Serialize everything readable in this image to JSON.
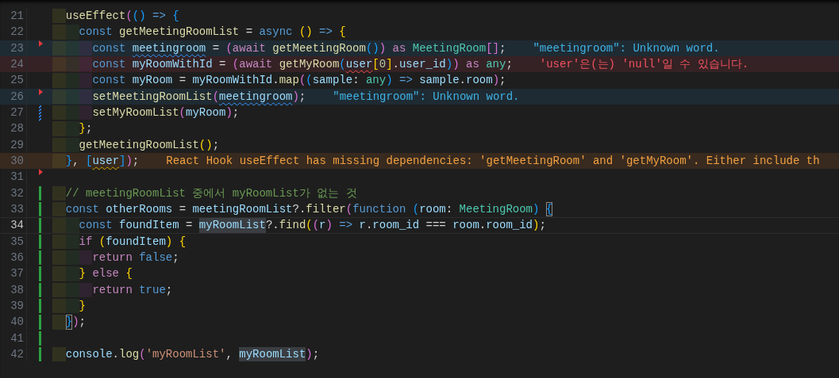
{
  "editor": {
    "lines": [
      {
        "number": "21",
        "current": false,
        "tokens": [
          {
            "kind": "fn",
            "text": "  useEffect"
          },
          {
            "kind": "b2",
            "text": "("
          },
          {
            "kind": "b3",
            "text": "()"
          },
          {
            "kind": "kw",
            "text": " => "
          },
          {
            "kind": "b3",
            "text": "{"
          }
        ]
      },
      {
        "number": "22",
        "current": false,
        "tokens": [
          {
            "kind": "kw",
            "text": "    const "
          },
          {
            "kind": "fn",
            "text": "getMeetingRoomList"
          },
          {
            "kind": "punc",
            "text": " = "
          },
          {
            "kind": "kw",
            "text": "async "
          },
          {
            "kind": "b1",
            "text": "()"
          },
          {
            "kind": "kw",
            "text": " => "
          },
          {
            "kind": "b1",
            "text": "{"
          }
        ]
      },
      {
        "number": "23",
        "current": false,
        "deleted": true,
        "tokens": [
          {
            "kind": "kw",
            "text": "      const "
          },
          {
            "kind": "var",
            "text": "meetingroom",
            "squiggled": true
          },
          {
            "kind": "punc",
            "text": " = "
          },
          {
            "kind": "b2",
            "text": "("
          },
          {
            "kind": "ctrl",
            "text": "await "
          },
          {
            "kind": "fn",
            "text": "getMeetingRoom"
          },
          {
            "kind": "b3",
            "text": "()"
          },
          {
            "kind": "b2",
            "text": ")"
          },
          {
            "kind": "ctrl",
            "text": " as "
          },
          {
            "kind": "type",
            "text": "MeetingRoom"
          },
          {
            "kind": "b2",
            "text": "[]"
          },
          {
            "kind": "punc",
            "text": ";"
          }
        ],
        "diagnostic": {
          "kind": "info",
          "text": "\"meetingroom\": Unknown word."
        }
      },
      {
        "number": "24",
        "current": false,
        "tokens": [
          {
            "kind": "kw",
            "text": "      const "
          },
          {
            "kind": "var",
            "text": "myRoomWithId"
          },
          {
            "kind": "punc",
            "text": " = "
          },
          {
            "kind": "b2",
            "text": "("
          },
          {
            "kind": "ctrl",
            "text": "await "
          },
          {
            "kind": "fn",
            "text": "getMyRoom"
          },
          {
            "kind": "b3",
            "text": "("
          },
          {
            "kind": "var",
            "text": "user",
            "squiggled": true
          },
          {
            "kind": "b1",
            "text": "["
          },
          {
            "kind": "num",
            "text": "0"
          },
          {
            "kind": "b1",
            "text": "]"
          },
          {
            "kind": "punc",
            "text": "."
          },
          {
            "kind": "var",
            "text": "user_id"
          },
          {
            "kind": "b3",
            "text": ")"
          },
          {
            "kind": "b2",
            "text": ")"
          },
          {
            "kind": "ctrl",
            "text": " as "
          },
          {
            "kind": "type",
            "text": "any"
          },
          {
            "kind": "punc",
            "text": ";"
          }
        ],
        "diagnostic": {
          "kind": "error",
          "text": "'user'은(는) 'null'일 수 있습니다."
        }
      },
      {
        "number": "25",
        "current": false,
        "tokens": [
          {
            "kind": "kw",
            "text": "      const "
          },
          {
            "kind": "var",
            "text": "myRoom"
          },
          {
            "kind": "punc",
            "text": " = "
          },
          {
            "kind": "var",
            "text": "myRoomWithId"
          },
          {
            "kind": "punc",
            "text": "."
          },
          {
            "kind": "fn",
            "text": "map"
          },
          {
            "kind": "b2",
            "text": "("
          },
          {
            "kind": "b3",
            "text": "("
          },
          {
            "kind": "var",
            "text": "sample"
          },
          {
            "kind": "punc",
            "text": ": "
          },
          {
            "kind": "type",
            "text": "any"
          },
          {
            "kind": "b3",
            "text": ")"
          },
          {
            "kind": "kw",
            "text": " => "
          },
          {
            "kind": "var",
            "text": "sample"
          },
          {
            "kind": "punc",
            "text": "."
          },
          {
            "kind": "var",
            "text": "room"
          },
          {
            "kind": "b2",
            "text": ")"
          },
          {
            "kind": "punc",
            "text": ";"
          }
        ]
      },
      {
        "number": "26",
        "current": false,
        "deleted": true,
        "tokens": [
          {
            "kind": "fn",
            "text": "      setMeetingRoomList"
          },
          {
            "kind": "b2",
            "text": "("
          },
          {
            "kind": "var",
            "text": "meetingroom",
            "squiggled": true
          },
          {
            "kind": "b2",
            "text": ")"
          },
          {
            "kind": "punc",
            "text": ";"
          }
        ],
        "diagnostic": {
          "kind": "info",
          "text": "\"meetingroom\": Unknown word."
        }
      },
      {
        "number": "27",
        "current": false,
        "modified": true,
        "tokens": [
          {
            "kind": "fn",
            "text": "      setMyRoomList"
          },
          {
            "kind": "b2",
            "text": "("
          },
          {
            "kind": "var",
            "text": "myRoom"
          },
          {
            "kind": "b2",
            "text": ")"
          },
          {
            "kind": "punc",
            "text": ";"
          }
        ]
      },
      {
        "number": "28",
        "current": false,
        "tokens": [
          {
            "kind": "b1",
            "text": "    }"
          },
          {
            "kind": "punc",
            "text": ";"
          }
        ]
      },
      {
        "number": "29",
        "current": false,
        "tokens": [
          {
            "kind": "fn",
            "text": "    getMeetingRoomList"
          },
          {
            "kind": "b1",
            "text": "()"
          },
          {
            "kind": "punc",
            "text": ";"
          }
        ]
      },
      {
        "number": "30",
        "current": false,
        "tokens": [
          {
            "kind": "b3",
            "text": "  }"
          },
          {
            "kind": "punc",
            "text": ", "
          },
          {
            "kind": "b3",
            "text": "["
          },
          {
            "kind": "var",
            "text": "user",
            "squiggled": true
          },
          {
            "kind": "b3",
            "text": "]"
          },
          {
            "kind": "b2",
            "text": ")"
          },
          {
            "kind": "punc",
            "text": ";"
          }
        ],
        "diagnostic": {
          "kind": "warning",
          "text": "React Hook useEffect has missing dependencies: 'getMeetingRoom' and 'getMyRoom'. Either include th"
        }
      },
      {
        "number": "31",
        "current": false,
        "deleted": true
      },
      {
        "number": "32",
        "current": false,
        "added": true,
        "tokens": [
          {
            "kind": "comment",
            "text": "  // meetingRoomList 중에서 myRoomList가 없는 것"
          }
        ]
      },
      {
        "number": "33",
        "current": false,
        "added": true,
        "tokens": [
          {
            "kind": "kw",
            "text": "  const "
          },
          {
            "kind": "var",
            "text": "otherRooms"
          },
          {
            "kind": "punc",
            "text": " = "
          },
          {
            "kind": "var",
            "text": "meetingRoomList"
          },
          {
            "kind": "punc",
            "text": "?."
          },
          {
            "kind": "fn",
            "text": "filter"
          },
          {
            "kind": "b2",
            "text": "("
          },
          {
            "kind": "kw",
            "text": "function "
          },
          {
            "kind": "b3",
            "text": "("
          },
          {
            "kind": "var",
            "text": "room"
          },
          {
            "kind": "punc",
            "text": ": "
          },
          {
            "kind": "type",
            "text": "MeetingRoom"
          },
          {
            "kind": "b3",
            "text": ") "
          },
          {
            "kind": "b3",
            "text": "{",
            "matched": true
          }
        ]
      },
      {
        "number": "34",
        "current": true,
        "added": true,
        "tokens": [
          {
            "kind": "kw",
            "text": "    const "
          },
          {
            "kind": "var",
            "text": "foundItem"
          },
          {
            "kind": "punc",
            "text": " = "
          },
          {
            "kind": "var",
            "text": "myRoomList",
            "highlighted": true
          },
          {
            "kind": "punc",
            "text": "?."
          },
          {
            "kind": "fn",
            "text": "find"
          },
          {
            "kind": "b1",
            "text": "("
          },
          {
            "kind": "b2",
            "text": "("
          },
          {
            "kind": "var",
            "text": "r"
          },
          {
            "kind": "b2",
            "text": ")"
          },
          {
            "kind": "kw",
            "text": " => "
          },
          {
            "kind": "var",
            "text": "r"
          },
          {
            "kind": "punc",
            "text": "."
          },
          {
            "kind": "var",
            "text": "room_id"
          },
          {
            "kind": "punc",
            "text": " === "
          },
          {
            "kind": "var",
            "text": "room"
          },
          {
            "kind": "punc",
            "text": "."
          },
          {
            "kind": "var",
            "text": "room_id"
          },
          {
            "kind": "b1",
            "text": ")"
          },
          {
            "kind": "punc",
            "text": ";"
          }
        ]
      },
      {
        "number": "35",
        "current": false,
        "added": true,
        "tokens": [
          {
            "kind": "ctrl",
            "text": "    if "
          },
          {
            "kind": "b1",
            "text": "("
          },
          {
            "kind": "var",
            "text": "foundItem"
          },
          {
            "kind": "b1",
            "text": ") "
          },
          {
            "kind": "b1",
            "text": "{"
          }
        ]
      },
      {
        "number": "36",
        "current": false,
        "added": true,
        "tokens": [
          {
            "kind": "ctrl",
            "text": "      return "
          },
          {
            "kind": "kw",
            "text": "false"
          },
          {
            "kind": "punc",
            "text": ";"
          }
        ]
      },
      {
        "number": "37",
        "current": false,
        "added": true,
        "tokens": [
          {
            "kind": "b1",
            "text": "    }"
          },
          {
            "kind": "ctrl",
            "text": " else "
          },
          {
            "kind": "b1",
            "text": "{"
          }
        ]
      },
      {
        "number": "38",
        "current": false,
        "added": true,
        "tokens": [
          {
            "kind": "ctrl",
            "text": "      return "
          },
          {
            "kind": "kw",
            "text": "true"
          },
          {
            "kind": "punc",
            "text": ";"
          }
        ]
      },
      {
        "number": "39",
        "current": false,
        "added": true,
        "tokens": [
          {
            "kind": "b1",
            "text": "    }"
          }
        ]
      },
      {
        "number": "40",
        "current": false,
        "added": true,
        "tokens": [
          {
            "kind": "b3",
            "text": "  }",
            "matched": true
          },
          {
            "kind": "b2",
            "text": ")"
          },
          {
            "kind": "punc",
            "text": ";"
          }
        ]
      },
      {
        "number": "41",
        "current": false,
        "added": true
      },
      {
        "number": "42",
        "current": false,
        "added": true,
        "tokens": [
          {
            "kind": "var",
            "text": "  console"
          },
          {
            "kind": "punc",
            "text": "."
          },
          {
            "kind": "fn",
            "text": "log"
          },
          {
            "kind": "b2",
            "text": "("
          },
          {
            "kind": "str",
            "text": "'myRoomList'"
          },
          {
            "kind": "punc",
            "text": ", "
          },
          {
            "kind": "var",
            "text": "myRoomList",
            "highlighted": true
          },
          {
            "kind": "b2",
            "text": ")"
          },
          {
            "kind": "punc",
            "text": ";"
          }
        ]
      }
    ]
  }
}
